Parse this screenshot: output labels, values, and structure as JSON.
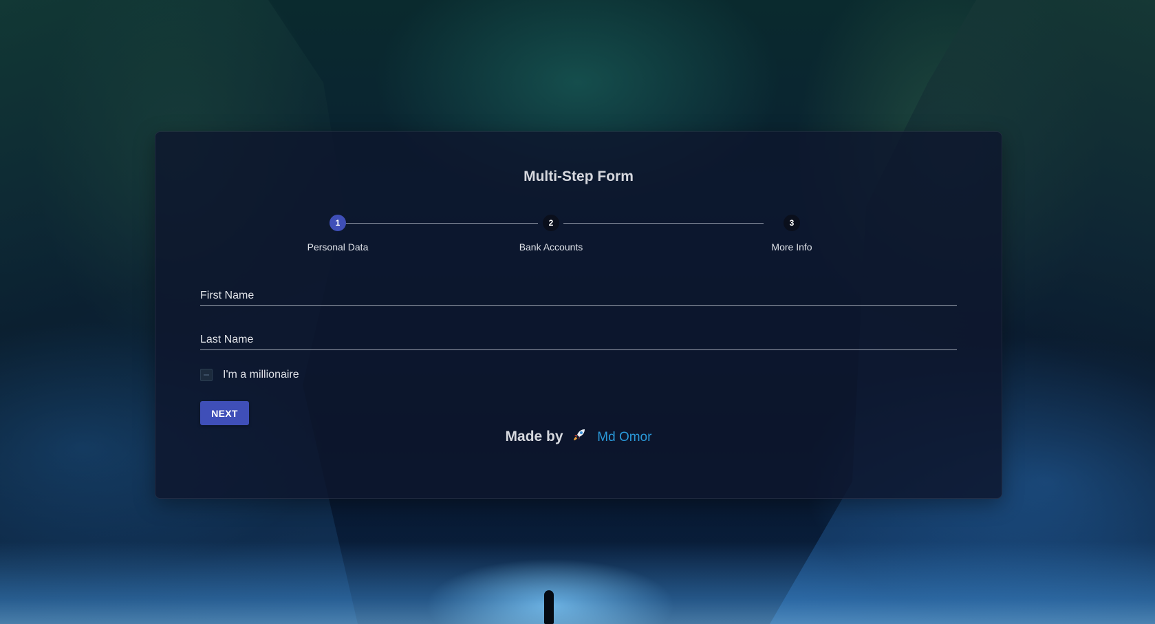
{
  "form": {
    "title": "Multi-Step Form",
    "steps": [
      {
        "number": "1",
        "label": "Personal Data",
        "active": true
      },
      {
        "number": "2",
        "label": "Bank Accounts",
        "active": false
      },
      {
        "number": "3",
        "label": "More Info",
        "active": false
      }
    ],
    "fields": {
      "first_name": {
        "placeholder": "First Name",
        "value": ""
      },
      "last_name": {
        "placeholder": "Last Name",
        "value": ""
      }
    },
    "checkbox": {
      "label": "I'm a millionaire",
      "checked": false
    },
    "next_label": "NEXT"
  },
  "footer": {
    "made_by": "Made by",
    "author": "Md Omor"
  },
  "colors": {
    "accent": "#3f4fb8",
    "link": "#2a98d8",
    "card_bg": "#0e162d"
  },
  "icons": {
    "rocket": "rocket-icon"
  }
}
